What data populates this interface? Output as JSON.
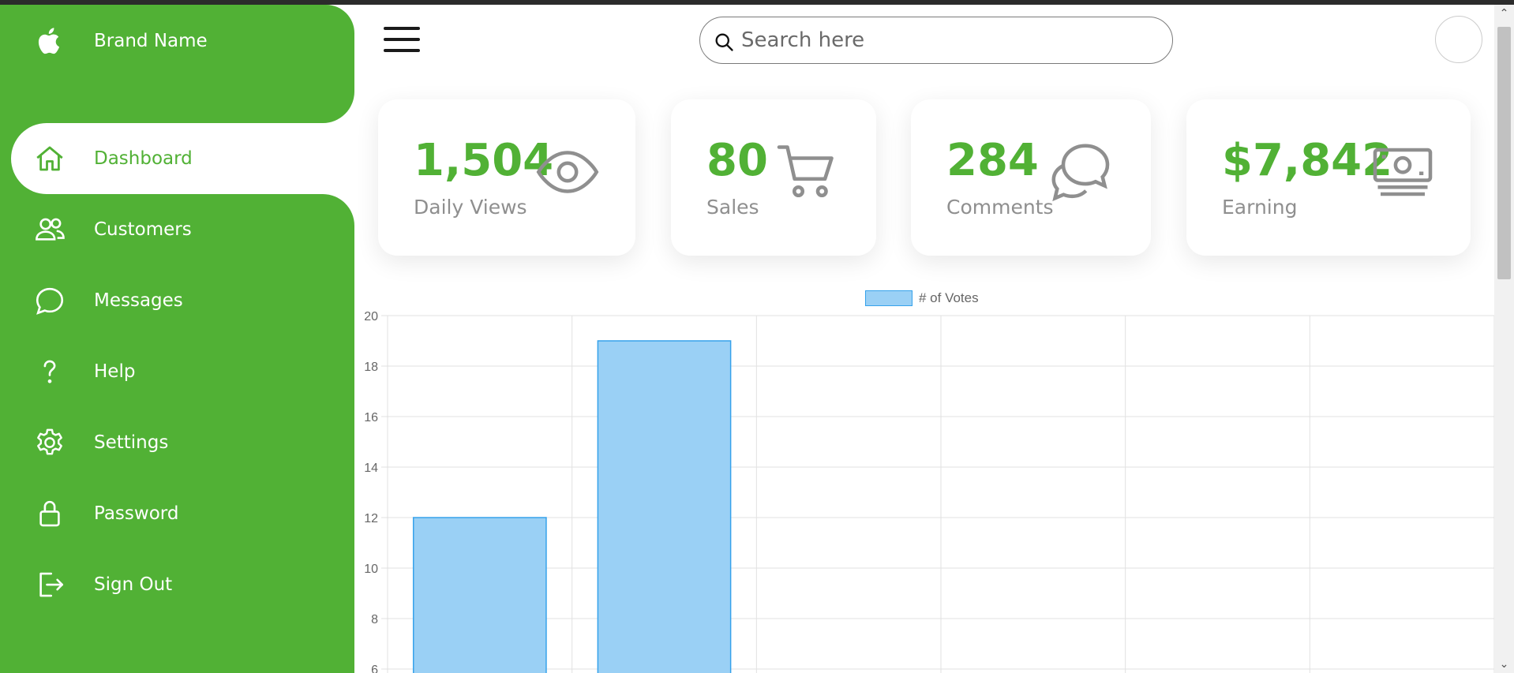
{
  "sidebar": {
    "brand": {
      "label": "Brand Name",
      "icon": "apple-icon"
    },
    "items": [
      {
        "label": "Dashboard",
        "icon": "home-icon"
      },
      {
        "label": "Customers",
        "icon": "people-icon"
      },
      {
        "label": "Messages",
        "icon": "chat-bubble-icon"
      },
      {
        "label": "Help",
        "icon": "question-icon"
      },
      {
        "label": "Settings",
        "icon": "gear-icon"
      },
      {
        "label": "Password",
        "icon": "lock-icon"
      },
      {
        "label": "Sign Out",
        "icon": "log-out-icon"
      }
    ],
    "active_item": "Dashboard",
    "color": "#51b135"
  },
  "header": {
    "search_placeholder": "Search here"
  },
  "cards": [
    {
      "value": "1,504",
      "label": "Daily Views",
      "icon": "eye-icon"
    },
    {
      "value": "80",
      "label": "Sales",
      "icon": "cart-icon"
    },
    {
      "value": "284",
      "label": "Comments",
      "icon": "chat-bubbles-icon"
    },
    {
      "value": "$7,842",
      "label": "Earning",
      "icon": "cash-icon"
    }
  ],
  "colors": {
    "accent": "#51b135",
    "muted_text": "#8f8f8f",
    "bar_fill": "#9ad0f5",
    "bar_border": "#36a2eb"
  },
  "chart_data": {
    "type": "bar",
    "series": [
      {
        "name": "# of Votes",
        "values": [
          12,
          19
        ]
      }
    ],
    "categories_visible_count": 6,
    "y_ticks": [
      20,
      18,
      16,
      14,
      12,
      10,
      8,
      6
    ],
    "ylim": [
      6,
      20
    ],
    "grid": true,
    "legend": "top-center"
  }
}
